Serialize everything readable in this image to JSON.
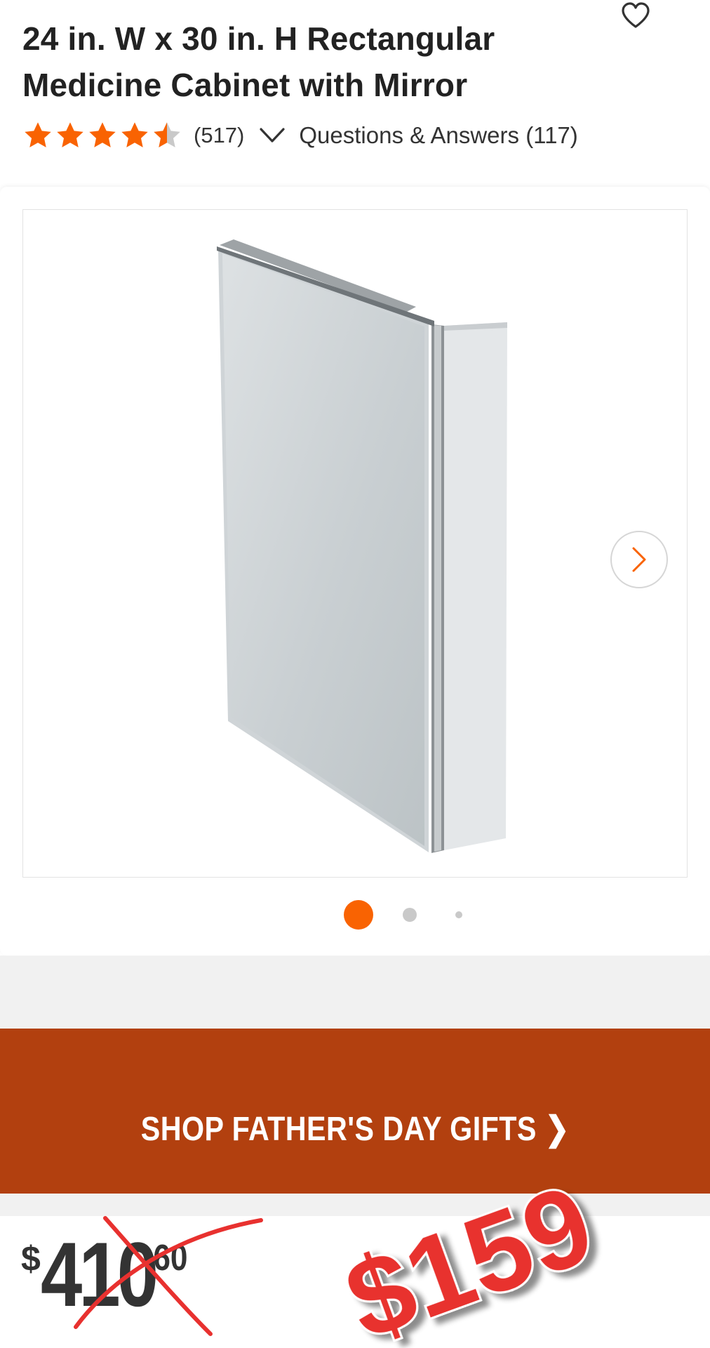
{
  "product": {
    "title_line1": "24 in. W x 30 in. H Rectangular",
    "title_line2": "Medicine Cabinet with Mirror",
    "rating": 4.5,
    "review_count": "(517)",
    "qa_label": "Questions & Answers (117)"
  },
  "gallery": {
    "image_count": 3,
    "active_index": 0
  },
  "promo": {
    "label": "SHOP FATHER'S DAY GIFTS ❯"
  },
  "price": {
    "currency": "$",
    "old_dollars": "410",
    "old_cents": "60",
    "sale_text": "$159"
  },
  "colors": {
    "accent": "#f96302",
    "banner": "#b2400f",
    "sale_red": "#e8312f",
    "text": "#333333"
  },
  "icons": [
    "heart-icon",
    "star-icon",
    "chevron-down-icon",
    "chevron-right-icon"
  ]
}
